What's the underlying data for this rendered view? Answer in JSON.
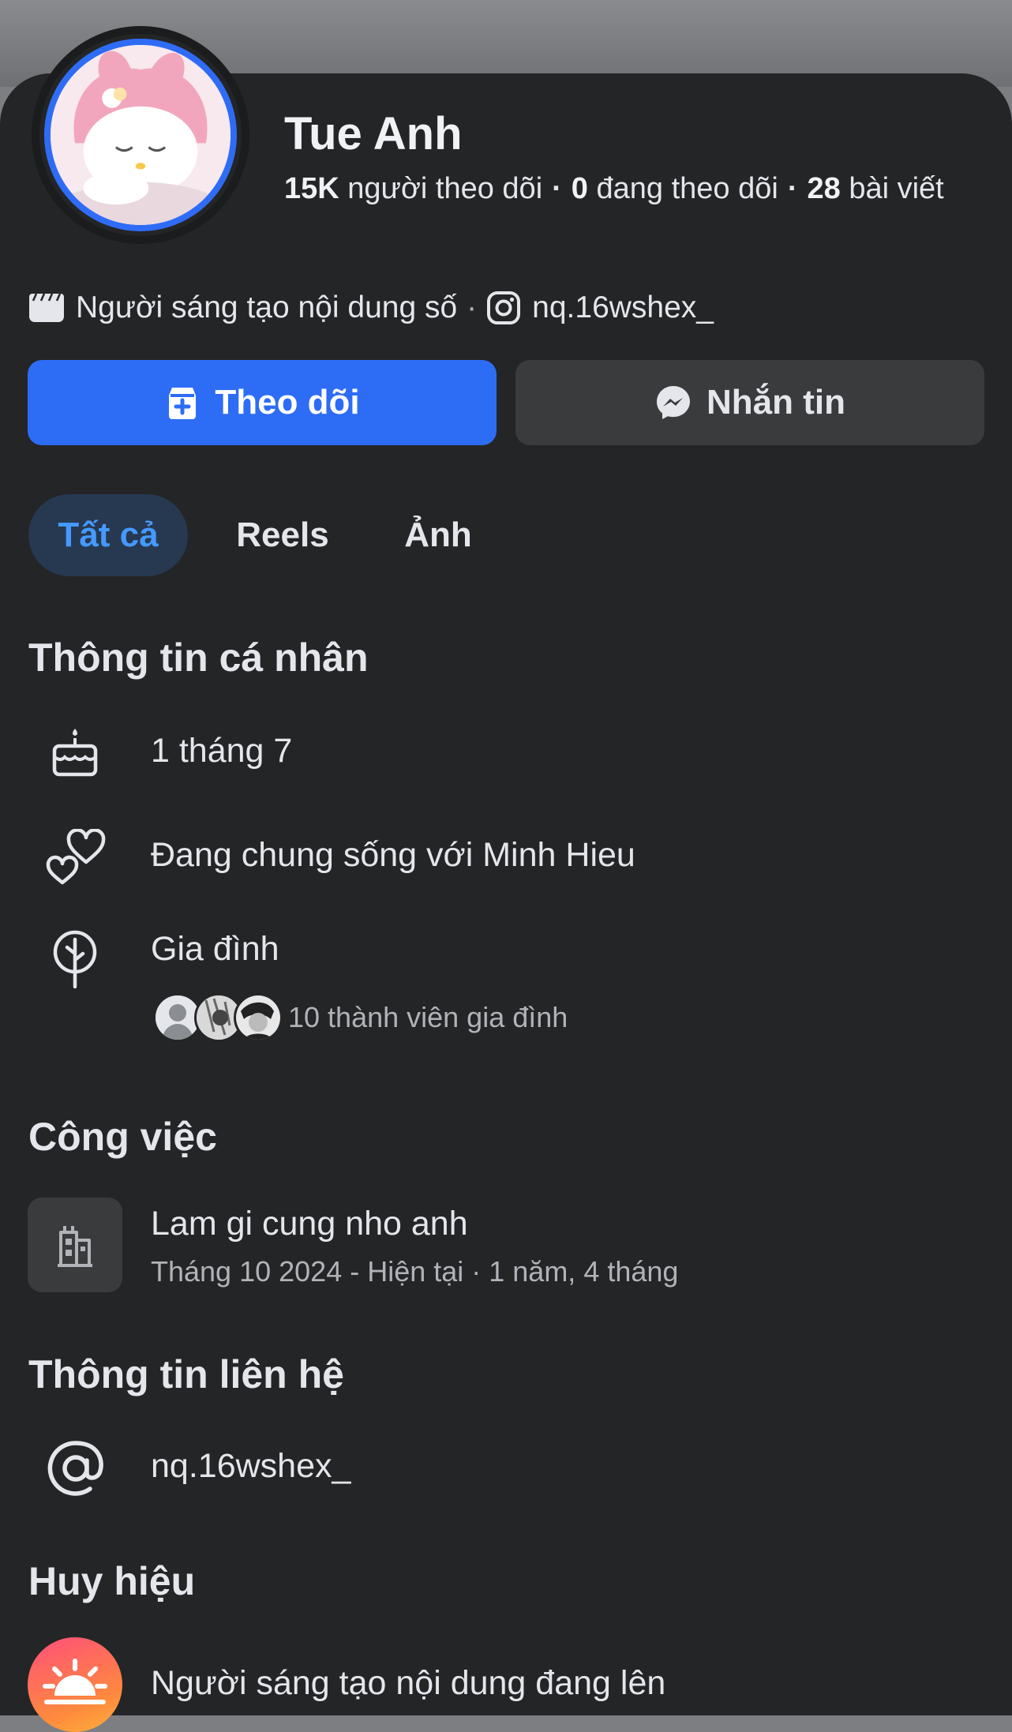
{
  "profile": {
    "name": "Tue Anh",
    "followers_count": "15K",
    "followers_label": "người theo dõi",
    "following_count": "0",
    "following_label": "đang theo dõi",
    "posts_count": "28",
    "posts_label": "bài viết",
    "category": "Người sáng tạo nội dung số",
    "instagram": "nq.16wshex_"
  },
  "actions": {
    "follow_label": "Theo dõi",
    "message_label": "Nhắn tin"
  },
  "tabs": [
    {
      "label": "Tất cả",
      "active": true
    },
    {
      "label": "Reels",
      "active": false
    },
    {
      "label": "Ảnh",
      "active": false
    }
  ],
  "personal_info": {
    "title": "Thông tin cá nhân",
    "birthday": "1 tháng 7",
    "relationship": "Đang chung sống với Minh Hieu",
    "family_label": "Gia đình",
    "family_members": "10 thành viên gia đình"
  },
  "work": {
    "title": "Công việc",
    "company": "Lam gi cung nho anh",
    "period": "Tháng 10 2024 - Hiện tại · 1 năm, 4 tháng"
  },
  "contact": {
    "title": "Thông tin liên hệ",
    "handle": "nq.16wshex_"
  },
  "badges": {
    "title": "Huy hiệu",
    "badge_label": "Người sáng tạo nội dung đang lên"
  },
  "colors": {
    "background": "#242526",
    "accent": "#2d6cf5",
    "active_tab_bg": "#263951",
    "active_tab_text": "#4599ff",
    "secondary_button": "#3a3b3c"
  },
  "icons": {
    "meta_category": "clapperboard-icon",
    "meta_instagram": "instagram-icon",
    "follow": "follow-add-icon",
    "message": "messenger-icon",
    "birthday": "birthday-cake-icon",
    "relationship": "hearts-icon",
    "family": "family-tree-icon",
    "work": "building-icon",
    "contact": "at-sign-icon",
    "badge": "sunrise-badge-icon"
  }
}
